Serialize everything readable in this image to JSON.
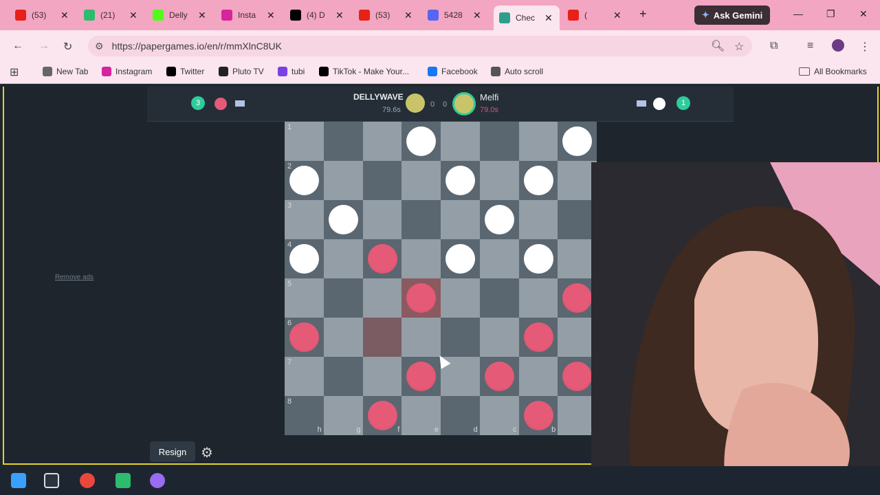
{
  "browser": {
    "tabs": [
      {
        "label": "(53) ",
        "color": "#e62117"
      },
      {
        "label": "(21) ",
        "color": "#2dbb6e"
      },
      {
        "label": "Delly",
        "color": "#53fc18"
      },
      {
        "label": "Insta",
        "color": "#d6249f"
      },
      {
        "label": "(4) D",
        "color": "#000000"
      },
      {
        "label": "(53) ",
        "color": "#e62117"
      },
      {
        "label": "5428",
        "color": "#5865f2"
      },
      {
        "label": "Chec",
        "color": "#2b9f8b"
      },
      {
        "label": "(",
        "color": "#e62117"
      }
    ],
    "gemini_label": "Ask Gemini",
    "url": "https://papergames.io/en/r/mmXlnC8UK",
    "bookmarks": [
      "New Tab",
      "Instagram",
      "Twitter",
      "Pluto TV",
      "tubi",
      "TikTok - Make Your...",
      "Facebook",
      "Auto scroll"
    ],
    "all_bookmarks_label": "All Bookmarks"
  },
  "game": {
    "remove_ads": "Remove ads",
    "player1": {
      "name": "DELLYWAVE",
      "time": "79.6s",
      "count": "3",
      "score": "0"
    },
    "player2": {
      "name": "Melfi",
      "time": "79.0s",
      "count": "1",
      "score": "0"
    },
    "rank_labels": [
      "1",
      "2",
      "3",
      "4",
      "5",
      "6",
      "7",
      "8"
    ],
    "file_labels": [
      "h",
      "g",
      "f",
      "e",
      "d",
      "c",
      "b",
      "a"
    ],
    "board": [
      [
        "",
        "",
        "",
        "w",
        "",
        "",
        "",
        "w"
      ],
      [
        "w",
        "",
        "",
        "",
        "w",
        "",
        "w",
        ""
      ],
      [
        "",
        "w",
        "",
        "",
        "",
        "w",
        "",
        ""
      ],
      [
        "w",
        "",
        "r",
        "",
        "w",
        "",
        "w",
        ""
      ],
      [
        "",
        "",
        "",
        "r",
        "",
        "",
        "",
        "r"
      ],
      [
        "r",
        "",
        "",
        "",
        "",
        "",
        "r",
        ""
      ],
      [
        "",
        "",
        "",
        "r",
        "",
        "r",
        "",
        "r"
      ],
      [
        "",
        "",
        "r",
        "",
        "",
        "",
        "r",
        ""
      ]
    ],
    "highlight_squares": [
      "4,3",
      "5,2"
    ],
    "resign_label": "Resign",
    "colors": {
      "red": "#e55a76",
      "white": "#ffffff",
      "accent": "#2ecc9a"
    }
  }
}
